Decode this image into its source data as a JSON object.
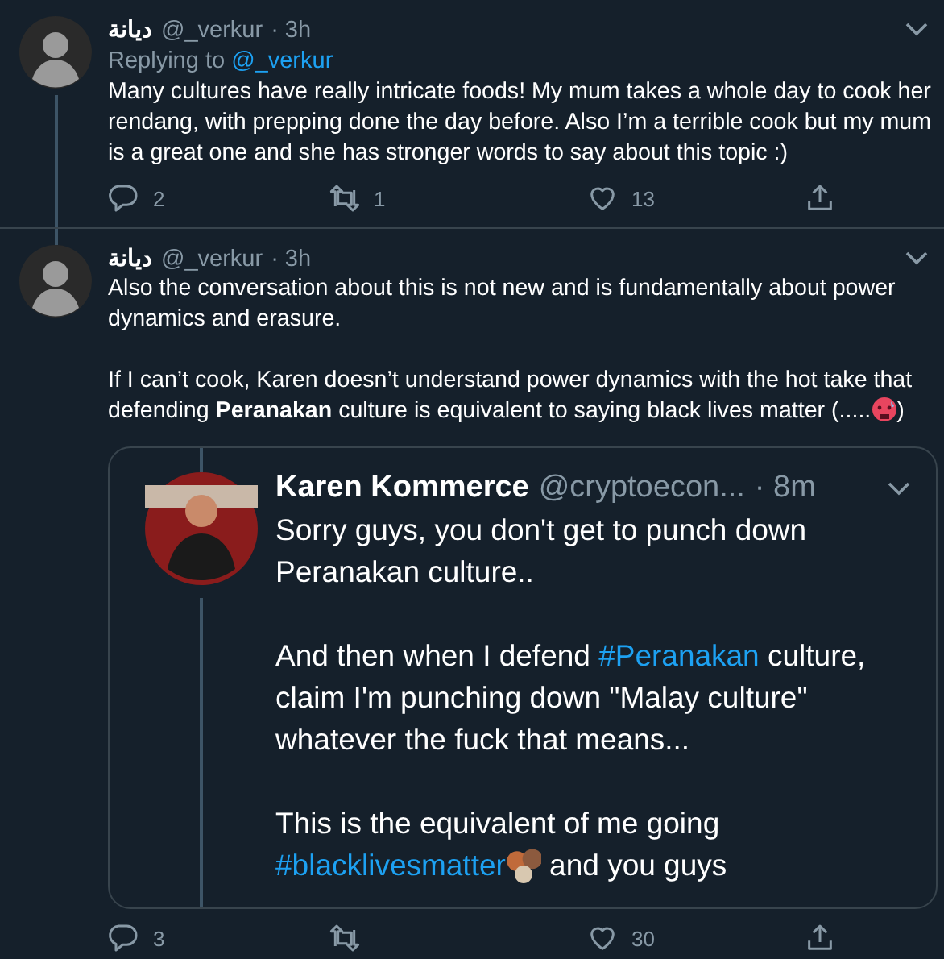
{
  "tweets": [
    {
      "name": "ديانة",
      "handle": "@_verkur",
      "time": "· 3h",
      "thread_continues": true,
      "replying_to": {
        "label": "Replying to",
        "handle": "@_verkur"
      },
      "paragraphs": [
        [
          {
            "kind": "text",
            "text": "Many cultures have really intricate foods! My mum takes a whole day to cook her rendang, with prepping done the day before. Also I’m a terrible cook but my mum is a great one and she has stronger words to say about this topic :)"
          }
        ]
      ],
      "actions": [
        {
          "kind": "reply",
          "count": "2"
        },
        {
          "kind": "retweet",
          "count": "1"
        },
        {
          "kind": "like",
          "count": "13"
        },
        {
          "kind": "share"
        }
      ]
    },
    {
      "name": "ديانة",
      "handle": "@_verkur",
      "time": "· 3h",
      "thread_continues": false,
      "paragraphs": [
        [
          {
            "kind": "text",
            "text": "Also the conversation about this is not new and is fundamentally about power dynamics and erasure."
          }
        ],
        [
          {
            "kind": "text",
            "text": "If I can’t cook, Karen doesn’t understand power dynamics with the hot take that defending **Peranakan** culture is equivalent to saying black lives matter (....."
          },
          {
            "kind": "emoji"
          },
          {
            "kind": "text",
            "text": ")"
          }
        ]
      ],
      "quote": {
        "name": "Karen Kommerce",
        "handle": "@cryptoecon...",
        "time": "· 8m",
        "paragraphs": [
          [
            {
              "kind": "text",
              "text": "Sorry guys, you don't get to punch down Peranakan culture.."
            }
          ],
          [
            {
              "kind": "text",
              "text": "And then when I defend "
            },
            {
              "kind": "hashtag",
              "text": "#Peranakan"
            },
            {
              "kind": "text",
              "text": " culture, claim I'm punching down \"Malay culture\" whatever the fuck that means..."
            }
          ],
          [
            {
              "kind": "text",
              "text": "This is the equivalent of me going "
            },
            {
              "kind": "hashtag",
              "text": "#blacklivesmatter"
            },
            {
              "kind": "emoji"
            },
            {
              "kind": "text",
              "text": " and you guys"
            }
          ]
        ]
      },
      "actions": [
        {
          "kind": "reply",
          "count": "3"
        },
        {
          "kind": "retweet"
        },
        {
          "kind": "like",
          "count": "30"
        },
        {
          "kind": "share"
        }
      ]
    }
  ]
}
